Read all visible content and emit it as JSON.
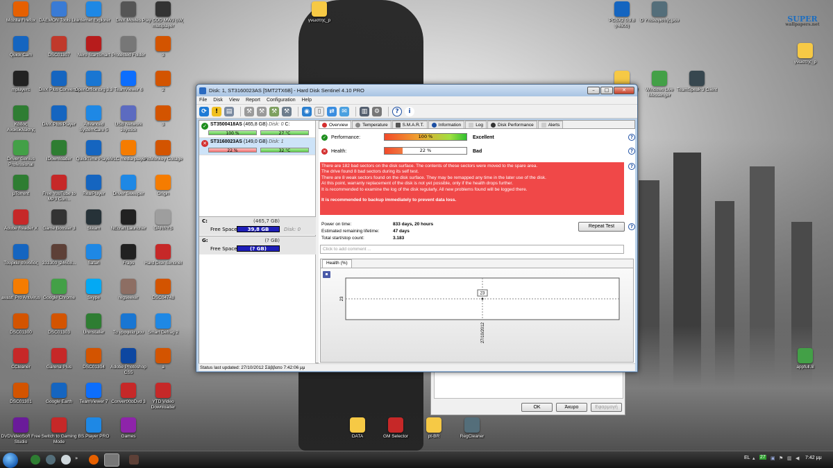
{
  "desktop": {
    "logo": {
      "line1": "SUPER",
      "line2": "wallpapers.net"
    },
    "icons": [
      {
        "label": "Mozilla Firefox",
        "icon": "firefox-icon",
        "color": "#e66000"
      },
      {
        "label": "DAEMON Tools Lite",
        "icon": "daemon-tools-icon",
        "color": "#3a7bd5"
      },
      {
        "label": "Internet Explorer",
        "icon": "internet-explorer-icon",
        "color": "#1e88e5"
      },
      {
        "label": "DivX Movies",
        "icon": "divx-movies-icon",
        "color": "#555555"
      },
      {
        "label": "Play COD MW3 (IW) multiplayer",
        "icon": "cod-mw3-icon",
        "color": "#333333"
      },
      {
        "label": "Quick Cam",
        "icon": "webcam-icon",
        "color": "#1565c0"
      },
      {
        "label": "DSC01307",
        "icon": "image-icon",
        "color": "#c0392b"
      },
      {
        "label": "Nero StartSmart",
        "icon": "nero-icon",
        "color": "#b71c1c"
      },
      {
        "label": "Protected Folder",
        "icon": "protected-folder-icon",
        "color": "#777777"
      },
      {
        "label": "3",
        "icon": "image-icon",
        "color": "#d35400"
      },
      {
        "label": "mplayerc",
        "icon": "media-player-icon",
        "color": "#222222"
      },
      {
        "label": "DivX Plus Converter",
        "icon": "divx-converter-icon",
        "color": "#1565c0"
      },
      {
        "label": "OpenOffice.org 3.3",
        "icon": "openoffice-icon",
        "color": "#1976d2"
      },
      {
        "label": "TeamViewer 6",
        "icon": "teamviewer-icon",
        "color": "#0d6efd"
      },
      {
        "label": "2",
        "icon": "image-icon",
        "color": "#d35400"
      },
      {
        "label": "Κάδος Ανακύκλωσης",
        "icon": "recycle-bin-icon",
        "color": "#2e7d32"
      },
      {
        "label": "DivX Plus Player",
        "icon": "divx-player-icon",
        "color": "#1565c0"
      },
      {
        "label": "Advanced SystemCare 5",
        "icon": "systemcare-icon",
        "color": "#1e88e5"
      },
      {
        "label": "USB Network Joystick",
        "icon": "joystick-icon",
        "color": "#5c6bc0"
      },
      {
        "label": "3",
        "icon": "image-icon",
        "color": "#d35400"
      },
      {
        "label": "Driver Genius Professional",
        "icon": "driver-genius-icon",
        "color": "#43a047"
      },
      {
        "label": "IDownloader",
        "icon": "downloader-icon",
        "color": "#2e7d32"
      },
      {
        "label": "QuickTime Player",
        "icon": "quicktime-icon",
        "color": "#1565c0"
      },
      {
        "label": "VLC media player",
        "icon": "vlc-icon",
        "color": "#f57c00"
      },
      {
        "label": "PicMonkey Collage",
        "icon": "picmonkey-icon",
        "color": "#d35400"
      },
      {
        "label": "µTorrent",
        "icon": "utorrent-icon",
        "color": "#2e7d32"
      },
      {
        "label": "Free YouTube to MP3 Con...",
        "icon": "youtube-mp3-icon",
        "color": "#c62828"
      },
      {
        "label": "RealPlayer",
        "icon": "realplayer-icon",
        "color": "#1565c0"
      },
      {
        "label": "Driver Sweeper",
        "icon": "driver-sweeper-icon",
        "color": "#1e88e5"
      },
      {
        "label": "Origin",
        "icon": "origin-icon",
        "color": "#f57c00"
      },
      {
        "label": "Adobe Reader X",
        "icon": "adobe-reader-icon",
        "color": "#c62828"
      },
      {
        "label": "Game Booster 3",
        "icon": "game-booster-icon",
        "color": "#333333"
      },
      {
        "label": "Steam",
        "icon": "steam-icon",
        "color": "#263238"
      },
      {
        "label": "NEcraft Launcher",
        "icon": "launcher-icon",
        "color": "#212121"
      },
      {
        "label": "GARRYS",
        "icon": "text-file-icon",
        "color": "#9e9e9e"
      },
      {
        "label": "Τουρκία σύνοδος",
        "icon": "shortcut-icon",
        "color": "#1565c0"
      },
      {
        "label": "333300_24608...",
        "icon": "image-icon",
        "color": "#5d4037"
      },
      {
        "label": "Safari",
        "icon": "safari-icon",
        "color": "#1e88e5"
      },
      {
        "label": "Fraps",
        "icon": "fraps-icon",
        "color": "#212121"
      },
      {
        "label": "Hard Disk Sentinel",
        "icon": "hard-disk-sentinel-icon",
        "color": "#c62828"
      },
      {
        "label": "avast! Pro Antivirus",
        "icon": "avast-icon",
        "color": "#f57c00"
      },
      {
        "label": "Google Chrome",
        "icon": "chrome-icon",
        "color": "#43a047"
      },
      {
        "label": "Skype",
        "icon": "skype-icon",
        "color": "#03a9f4"
      },
      {
        "label": "regseeker",
        "icon": "regseeker-icon",
        "color": "#8d6e63"
      },
      {
        "label": "DSC04748",
        "icon": "image-icon",
        "color": "#d35400"
      },
      {
        "label": "DSC01300",
        "icon": "image-icon",
        "color": "#d35400"
      },
      {
        "label": "DSC01303",
        "icon": "image-icon",
        "color": "#d35400"
      },
      {
        "label": "Uninstaller",
        "icon": "uninstaller-icon",
        "color": "#2e7d32"
      },
      {
        "label": "Τα γραφεία μου",
        "icon": "folder-icon",
        "color": "#1976d2"
      },
      {
        "label": "Smart Defrag 2",
        "icon": "smart-defrag-icon",
        "color": "#1e88e5"
      },
      {
        "label": "CCleaner",
        "icon": "ccleaner-icon",
        "color": "#c62828"
      },
      {
        "label": "Garena Plus",
        "icon": "garena-icon",
        "color": "#c62828"
      },
      {
        "label": "DSC01304",
        "icon": "image-icon",
        "color": "#d35400"
      },
      {
        "label": "Adobe Photoshop CS5",
        "icon": "photoshop-icon",
        "color": "#0d47a1"
      },
      {
        "label": "a",
        "icon": "image-icon",
        "color": "#d35400"
      },
      {
        "label": "DSC01301",
        "icon": "image-icon",
        "color": "#d35400"
      },
      {
        "label": "Google Earth",
        "icon": "google-earth-icon",
        "color": "#1565c0"
      },
      {
        "label": "TeamViewer 7",
        "icon": "teamviewer-icon",
        "color": "#0d6efd"
      },
      {
        "label": "ConvertXtoDvd 3",
        "icon": "convertxtodvd-icon",
        "color": "#c62828"
      },
      {
        "label": "YTD Video Downloader",
        "icon": "ytd-icon",
        "color": "#c62828"
      },
      {
        "label": "DVDVideoSoft Free Studio",
        "icon": "dvdvideosoft-icon",
        "color": "#6a1b9a"
      },
      {
        "label": "Switch to Gaming Mode",
        "icon": "gaming-mode-icon",
        "color": "#c62828"
      },
      {
        "label": "BS.Player PRO",
        "icon": "bsplayer-icon",
        "color": "#1e88e5"
      },
      {
        "label": "Games",
        "icon": "games-icon",
        "color": "#8e24aa"
      },
      {
        "label": "γνωστης_p",
        "icon": "folder-icon",
        "color": "#f6c945"
      },
      {
        "label": "PCSX2 0.9.8 (r4600)",
        "icon": "pcsx2-icon",
        "color": "#1565c0"
      },
      {
        "label": "Ο Υπολογιστής μου",
        "icon": "computer-icon",
        "color": "#546e7a"
      },
      {
        "label": "γνωστης_p",
        "icon": "folder-icon",
        "color": "#f6c945"
      },
      {
        "label": "kerkomaaaaa!!!!",
        "icon": "folder-icon",
        "color": "#f6c945"
      },
      {
        "label": "Windows Live Messenger",
        "icon": "messenger-icon",
        "color": "#43a047"
      },
      {
        "label": "TeamSpeak 3 Client",
        "icon": "teamspeak-icon",
        "color": "#37474f"
      },
      {
        "label": "appfull.lil",
        "icon": "app-icon",
        "color": "#43a047"
      },
      {
        "label": "DATA",
        "icon": "folder-icon",
        "color": "#f6c945"
      },
      {
        "label": "GM Selector",
        "icon": "gm-selector-icon",
        "color": "#c62828"
      },
      {
        "label": "pt-BR",
        "icon": "folder-icon",
        "color": "#f6c945"
      },
      {
        "label": "RegCleaner",
        "icon": "regcleaner-icon",
        "color": "#546e7a"
      }
    ]
  },
  "window": {
    "title": "Disk: 1, ST3160023AS [5MT2TX6B]  -  Hard Disk Sentinel 4.10 PRO",
    "minimize": "–",
    "maximize": "□",
    "close": "✕",
    "menu": [
      "File",
      "Disk",
      "View",
      "Report",
      "Configuration",
      "Help"
    ],
    "disks": [
      {
        "model": "ST3500418AS",
        "size": "(465,8 GB)",
        "disk": "Disk: 0",
        "drives": "C:",
        "health": "100 %",
        "health_value": 100,
        "temp": "27 °C",
        "status": "ok",
        "status_color": "#1e8e1e"
      },
      {
        "model": "ST3160023AS",
        "size": "(149,0 GB)",
        "disk": "Disk: 1",
        "drives": "",
        "health": "22 %",
        "health_value": 22,
        "temp": "32 °C",
        "status": "bad",
        "status_color": "#d32f2f"
      }
    ],
    "drives": [
      {
        "letter": "C:",
        "size": "(465,7 GB)",
        "free_label": "Free Space",
        "free": "39,8 GB",
        "disk": "Disk: 0"
      },
      {
        "letter": "G:",
        "size": "(? GB)",
        "free_label": "Free Space",
        "free": "(? GB)",
        "disk": ""
      }
    ],
    "tabs": [
      "Overview",
      "Temperature",
      "S.M.A.R.T.",
      "Information",
      "Log",
      "Disk Performance",
      "Alerts"
    ],
    "overview": {
      "performance_label": "Performance:",
      "performance_value": "100 %",
      "performance_fraction": 1.0,
      "performance_rating": "Excellent",
      "health_label": "Health:",
      "health_value": "22 %",
      "health_fraction": 0.22,
      "health_rating": "Bad",
      "alert_lines": [
        "There are 182 bad sectors on the disk surface. The contents of these sectors were moved to the spare area.",
        "The drive found 8 bad sectors during its self test.",
        "There are 8 weak sectors found on the disk surface. They may be remapped any time in the later use of the disk.",
        "At this point, warranty replacement of the disk is not yet possible, only if the health drops further.",
        "It is recommended to examine the log of the disk regularly. All new problems found will be logged there."
      ],
      "alert_strong": "It is recommended to backup immediately to prevent data loss.",
      "power_on_label": "Power on time:",
      "power_on_value": "833 days, 20 hours",
      "lifetime_label": "Estimated remaining lifetime:",
      "lifetime_value": "47 days",
      "startstop_label": "Total start/stop count:",
      "startstop_value": "3.183",
      "repeat_test": "Repeat Test",
      "comment_placeholder": "Click to add comment ..."
    },
    "chart_data": {
      "type": "line",
      "tab": "Health (%)",
      "x": [
        "27/10/2012"
      ],
      "values": [
        23
      ],
      "ytick": "23",
      "point_label": "23"
    },
    "status": "Status last updated: 27/10/2012 Σάββατο 7:42:06 μμ"
  },
  "dialog": {
    "ok": "OK",
    "cancel": "Άκυρο",
    "apply": "Εφαρμογή"
  },
  "taskbar": {
    "lang": "EL",
    "clock": "7:42 μμ",
    "badge": "27"
  }
}
